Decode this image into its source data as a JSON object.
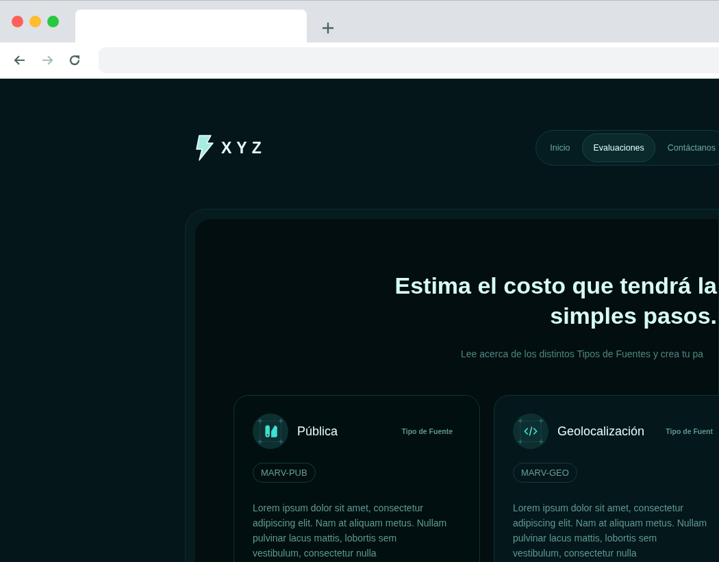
{
  "browser": {
    "nav_buttons": [
      {
        "kind": "back",
        "disabled": false
      },
      {
        "kind": "forward",
        "disabled": true
      },
      {
        "kind": "reload",
        "disabled": false
      }
    ]
  },
  "header": {
    "logo": "XYZ",
    "nav": [
      {
        "label": "Inicio",
        "selected": false
      },
      {
        "label": "Evaluaciones",
        "selected": true
      },
      {
        "label": "Contáctanos",
        "selected": false
      }
    ]
  },
  "hero": {
    "title": "Estima el costo que tendrá la\nsimples pasos.",
    "subtitle": "Lee acerca de los distintos Tipos de Fuentes y crea tu pa"
  },
  "cards": [
    {
      "kind": "public",
      "title": "Pública",
      "type_label": "Tipo de Fuente",
      "code": "MARV-PUB",
      "body": "Lorem ipsum dolor sit amet, consectetur\nadipiscing elit. Nam at aliquam metus. Nullam\npulvinar lacus mattis, lobortis sem\nvestibulum, consectetur nulla"
    },
    {
      "kind": "geo",
      "title": "Geolocalización",
      "type_label": "Tipo de Fuent",
      "code": "MARV-GEO",
      "body": "Lorem ipsum dolor sit amet, consectetur\nadipiscing elit. Nam at aliquam metus. Nullam\npulvinar lacus mattis, lobortis sem\nvestibulum, consectetur nulla"
    }
  ]
}
